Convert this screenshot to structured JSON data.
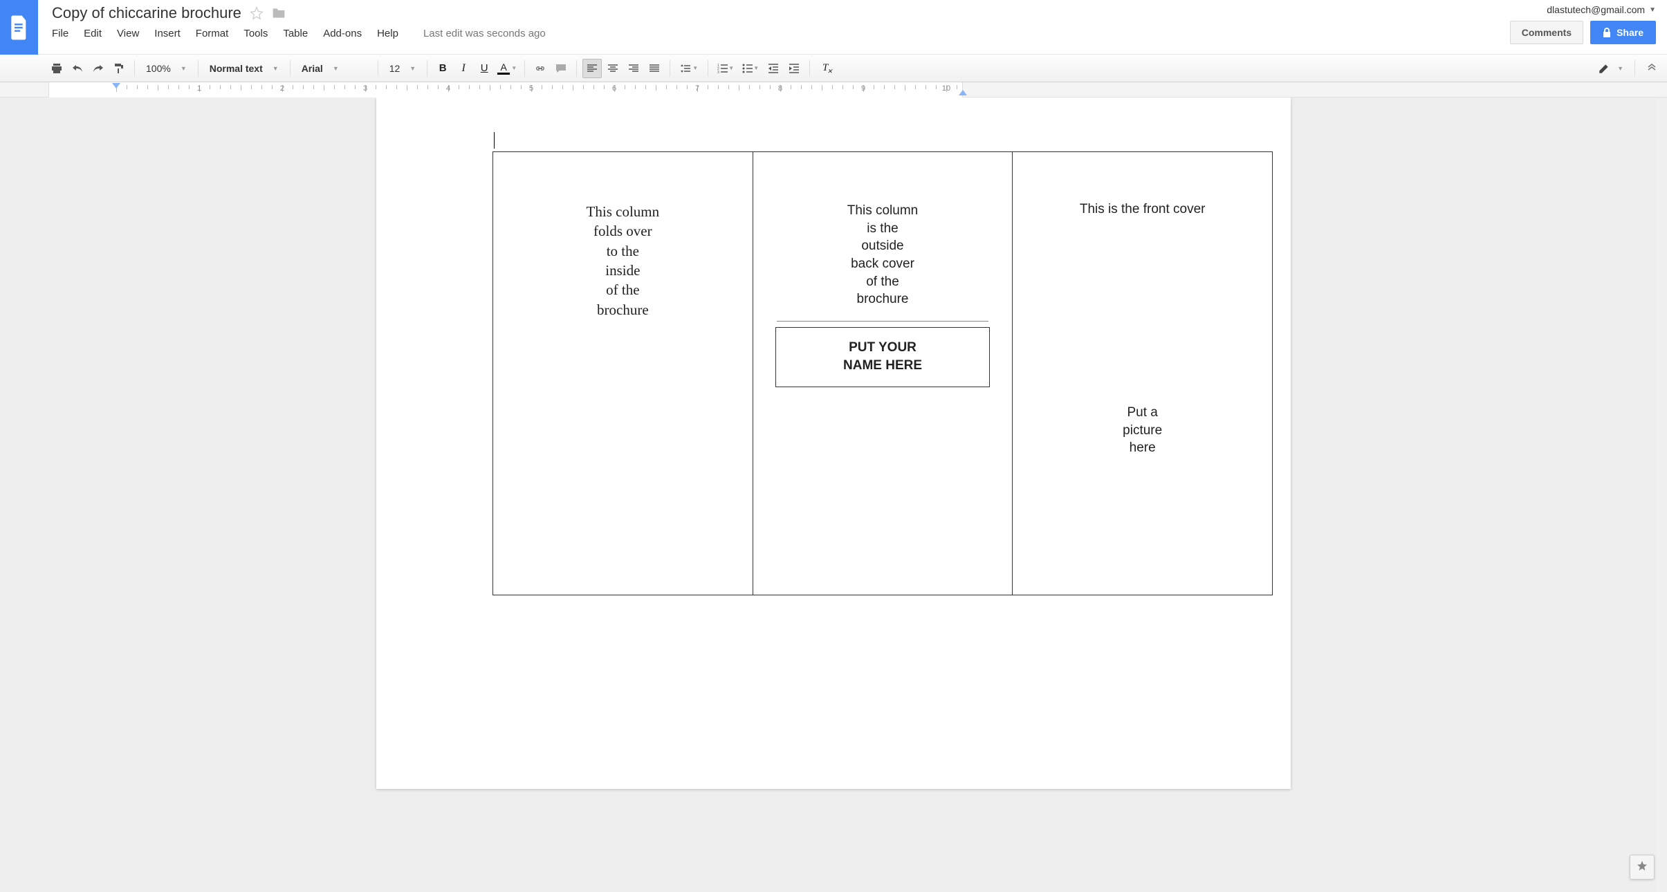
{
  "header": {
    "title": "Copy of chiccarine brochure",
    "user": "dlastutech@gmail.com",
    "comments_btn": "Comments",
    "share_btn": "Share"
  },
  "menus": {
    "file": "File",
    "edit": "Edit",
    "view": "View",
    "insert": "Insert",
    "format": "Format",
    "tools": "Tools",
    "table": "Table",
    "addons": "Add-ons",
    "help": "Help",
    "last_edit": "Last edit was seconds ago"
  },
  "toolbar": {
    "zoom": "100%",
    "style": "Normal text",
    "font": "Arial",
    "size": "12"
  },
  "ruler": {
    "numbers": [
      "1",
      "2",
      "3",
      "4",
      "5",
      "6",
      "7",
      "8",
      "9",
      "10"
    ]
  },
  "doc": {
    "col1": "This column\nfolds over\nto the\ninside\nof the\nbrochure",
    "col2_desc": "This column\nis the\noutside\nback cover\nof the\nbrochure",
    "col2_name": "PUT YOUR\nNAME HERE",
    "col3_front": "This is the front cover",
    "col3_pic": "Put a\npicture\nhere"
  }
}
